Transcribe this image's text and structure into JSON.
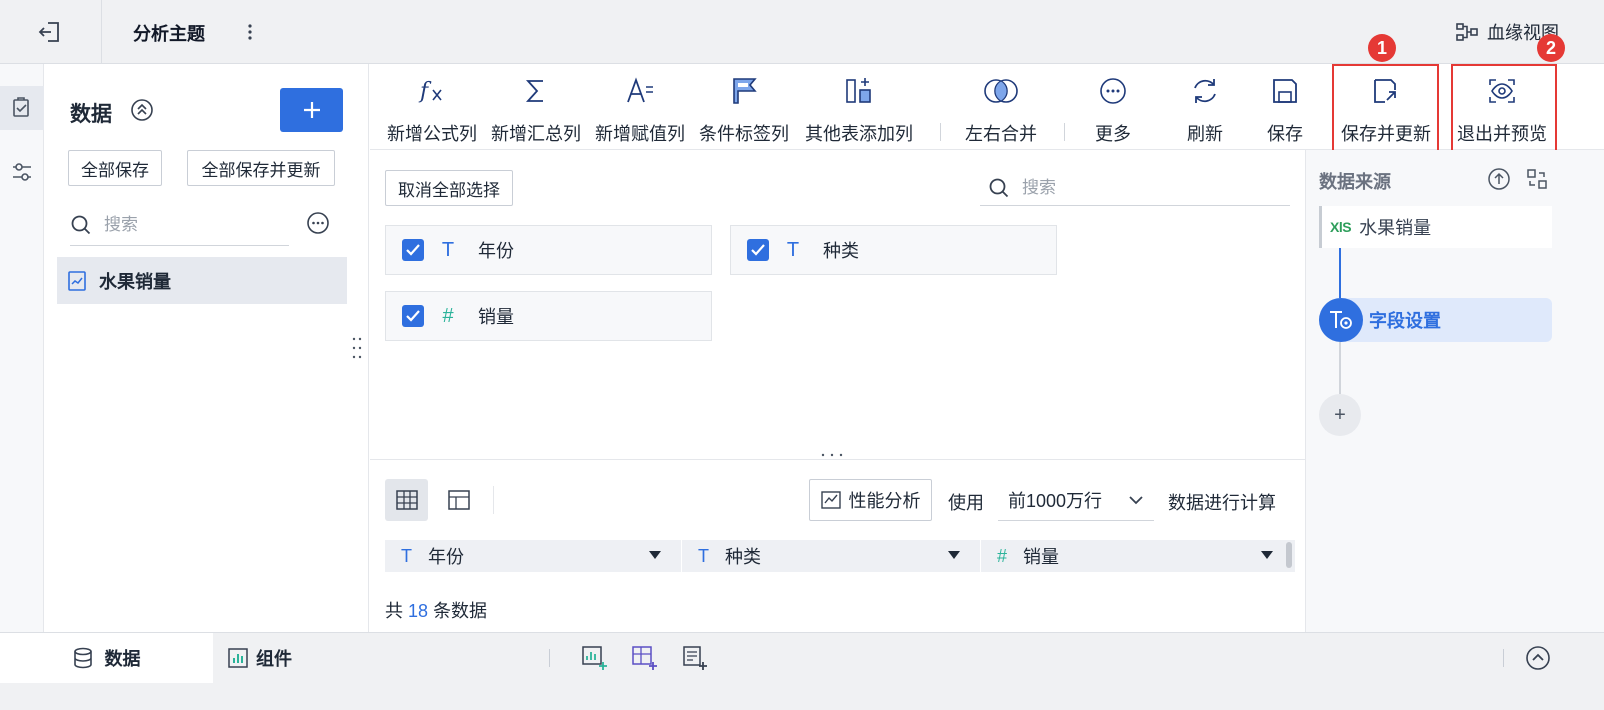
{
  "header": {
    "title": "分析主题",
    "lineage_label": "血缘视图"
  },
  "data_panel": {
    "title": "数据",
    "save_all": "全部保存",
    "save_all_update": "全部保存并更新",
    "search_placeholder": "搜索",
    "tables": [
      {
        "name": "水果销量"
      }
    ]
  },
  "toolbar": {
    "items": [
      {
        "label": "新增公式列",
        "icon": "formula-icon"
      },
      {
        "label": "新增汇总列",
        "icon": "sum-icon"
      },
      {
        "label": "新增赋值列",
        "icon": "assign-icon"
      },
      {
        "label": "条件标签列",
        "icon": "flag-icon"
      },
      {
        "label": "其他表添加列",
        "icon": "add-column-icon"
      },
      {
        "label": "左右合并",
        "icon": "merge-icon"
      },
      {
        "label": "更多",
        "icon": "more-icon"
      },
      {
        "label": "刷新",
        "icon": "refresh-icon"
      },
      {
        "label": "保存",
        "icon": "save-icon"
      },
      {
        "label": "保存并更新",
        "icon": "save-update-icon"
      },
      {
        "label": "退出并预览",
        "icon": "preview-icon"
      }
    ],
    "badges": [
      "1",
      "2"
    ],
    "highlight_color": "#e53935"
  },
  "fields": {
    "deselect_all": "取消全部选择",
    "search_placeholder": "搜索",
    "items": [
      {
        "name": "年份",
        "type": "text",
        "type_icon": "T",
        "checked": true
      },
      {
        "name": "种类",
        "type": "text",
        "type_icon": "T",
        "checked": true
      },
      {
        "name": "销量",
        "type": "number",
        "type_icon": "#",
        "checked": true
      }
    ]
  },
  "preview": {
    "perf_label": "性能分析",
    "use_label": "使用",
    "rows_option": "前1000万行",
    "calc_label": "数据进行计算",
    "columns": [
      {
        "name": "年份",
        "type_icon": "T"
      },
      {
        "name": "种类",
        "type_icon": "T"
      },
      {
        "name": "销量",
        "type_icon": "#"
      }
    ],
    "count_prefix": "共",
    "count": "18",
    "count_suffix": "条数据"
  },
  "source_panel": {
    "title": "数据来源",
    "source_badge": "XlS",
    "source_name": "水果销量",
    "step_label": "字段设置",
    "add_label": "+"
  },
  "bottom_tabs": {
    "data": "数据",
    "component": "组件"
  },
  "colors": {
    "accent": "#2f6fdf",
    "number_type": "#2bb39a",
    "highlight": "#e53935"
  }
}
